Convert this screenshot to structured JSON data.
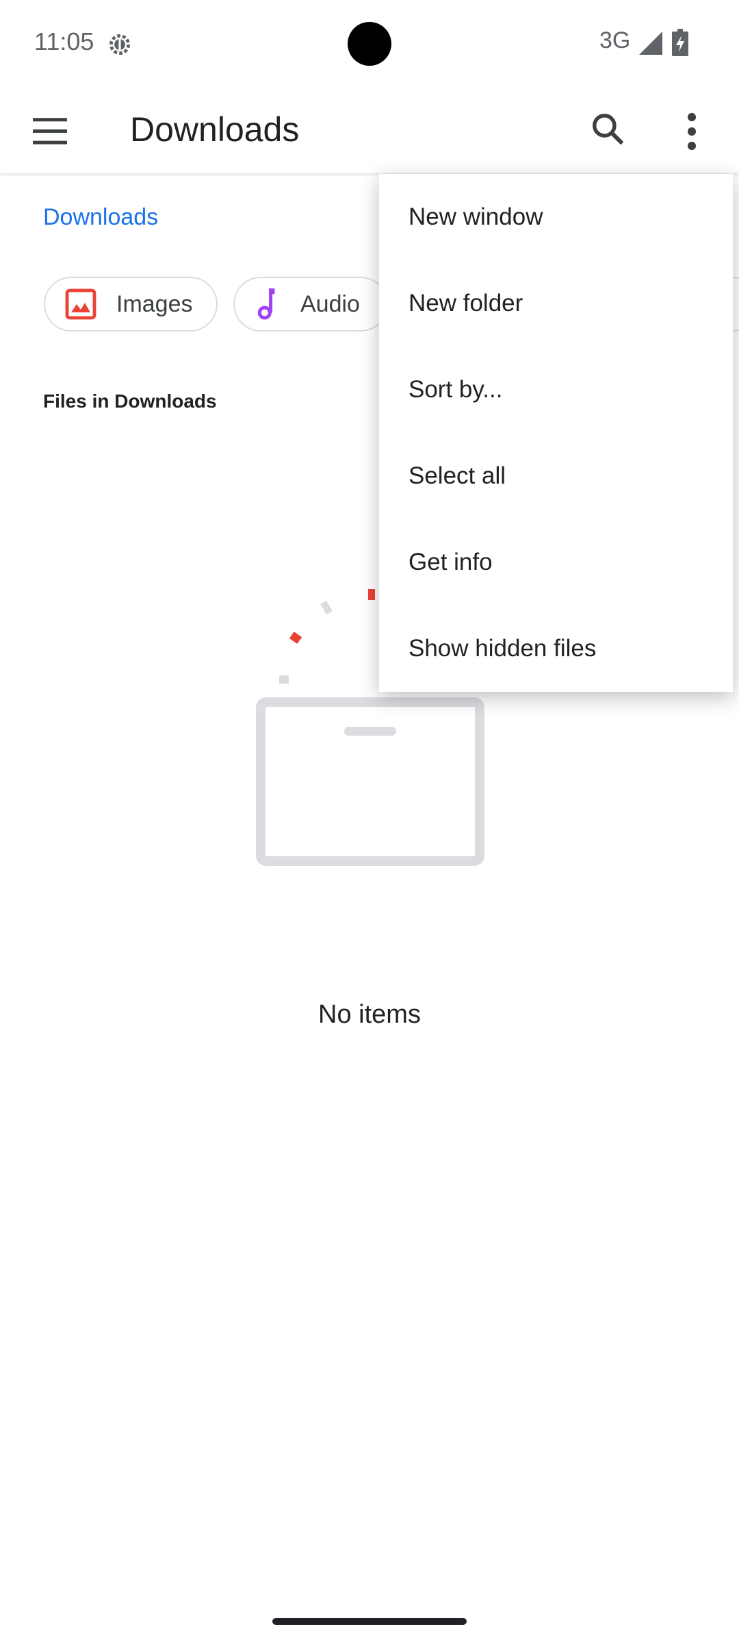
{
  "status_bar": {
    "time": "11:05",
    "network": "3G"
  },
  "app_bar": {
    "title": "Downloads",
    "icons": [
      "menu-icon",
      "search-icon",
      "more-vert-icon"
    ]
  },
  "breadcrumb": "Downloads",
  "chips": [
    {
      "label": "Images",
      "icon": "image-icon"
    },
    {
      "label": "Audio",
      "icon": "music-note-icon"
    }
  ],
  "section_label": "Files in Downloads",
  "empty_state": {
    "text": "No items"
  },
  "overflow_menu": {
    "items": [
      "New window",
      "New folder",
      "Sort by...",
      "Select all",
      "Get info",
      "Show hidden files"
    ]
  },
  "colors": {
    "accent": "#1a73e8",
    "images": "#ea4335",
    "audio": "#a142f4"
  }
}
